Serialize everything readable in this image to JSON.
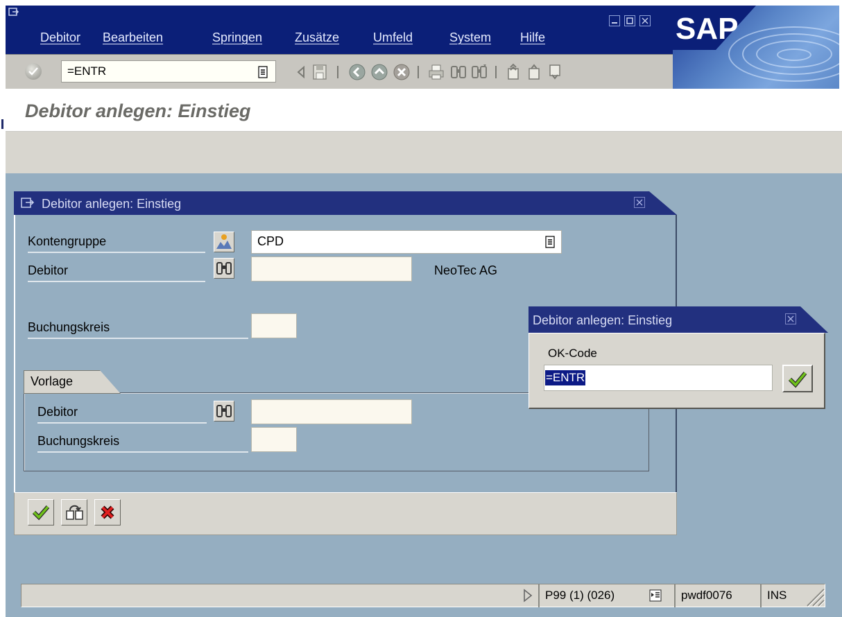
{
  "menubar": {
    "items": [
      "Debitor",
      "Bearbeiten",
      "Springen",
      "Zusätze",
      "Umfeld",
      "System",
      "Hilfe"
    ]
  },
  "brand": {
    "logo_text": "SAP"
  },
  "toolbar": {
    "command_field_value": "=ENTR",
    "icons": [
      "enter-icon",
      "history-dropdown-icon",
      "back-arrow-icon",
      "save-icon",
      "back-icon",
      "exit-icon",
      "cancel-icon",
      "print-icon",
      "find-icon",
      "find-next-icon",
      "first-page-icon",
      "previous-page-icon",
      "next-page-icon"
    ]
  },
  "title": {
    "text": "Debitor anlegen: Einstieg"
  },
  "dialog": {
    "title": "Debitor anlegen: Einstieg",
    "fields": {
      "kontengruppe": {
        "label": "Kontengruppe",
        "value": "CPD"
      },
      "debitor": {
        "label": "Debitor",
        "value": "",
        "description": "NeoTec AG"
      },
      "buchungskreis": {
        "label": "Buchungskreis",
        "value": ""
      }
    },
    "vorlage": {
      "tab_label": "Vorlage",
      "debitor_label": "Debitor",
      "debitor_value": "",
      "buchungskreis_label": "Buchungskreis",
      "buchungskreis_value": ""
    },
    "footer_buttons": [
      "continue-icon",
      "create-with-template-icon",
      "cancel-icon"
    ]
  },
  "popup": {
    "title": "Debitor anlegen: Einstieg",
    "label": "OK-Code",
    "value": "=ENTR"
  },
  "statusbar": {
    "session": "P99 (1) (026)",
    "server": "pwdf0076",
    "mode": "INS"
  },
  "colors": {
    "menubar_bg": "#0b1f78",
    "main_bg": "#95aec1",
    "dialog_header": "#22307f",
    "panel_bg": "#d8d6cf",
    "selection": "#0c1a86"
  }
}
